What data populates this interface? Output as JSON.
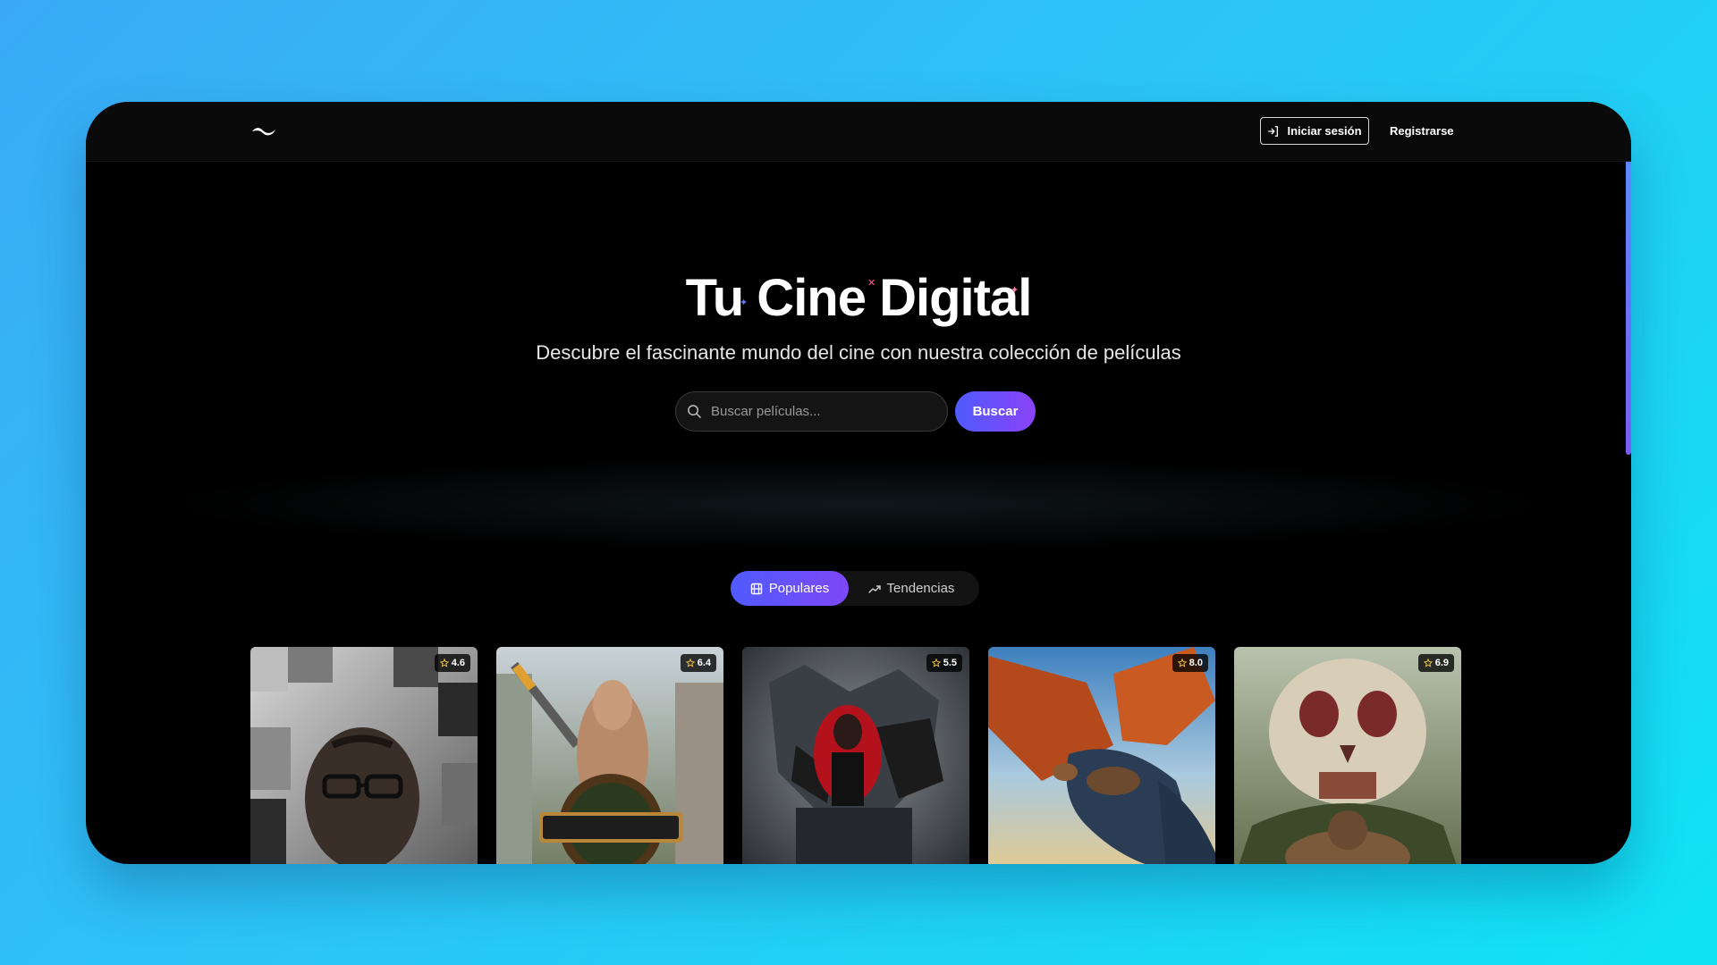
{
  "nav": {
    "logo_icon": "wave-logo-icon",
    "login_label": "Iniciar sesión",
    "login_icon": "login-arrow-icon",
    "register_label": "Registrarse"
  },
  "hero": {
    "title": "Tu Cine Digital",
    "subtitle": "Descubre el fascinante mundo del cine con nuestra colección de películas"
  },
  "search": {
    "placeholder": "Buscar películas...",
    "value": "",
    "button_label": "Buscar",
    "icon": "search-icon"
  },
  "tabs": [
    {
      "label": "Populares",
      "icon": "film-icon",
      "active": true
    },
    {
      "label": "Tendencias",
      "icon": "trending-up-icon",
      "active": false
    }
  ],
  "movies": [
    {
      "rating": "4.6"
    },
    {
      "rating": "6.4"
    },
    {
      "rating": "5.5"
    },
    {
      "rating": "8.0"
    },
    {
      "rating": "6.9"
    }
  ],
  "colors": {
    "page_gradient": [
      "#3aaaf6",
      "#0fe3f3"
    ],
    "accent_gradient": [
      "#4f5bff",
      "#8a42f5"
    ],
    "surface": "#000000",
    "navbar": "#0a0a0a"
  }
}
